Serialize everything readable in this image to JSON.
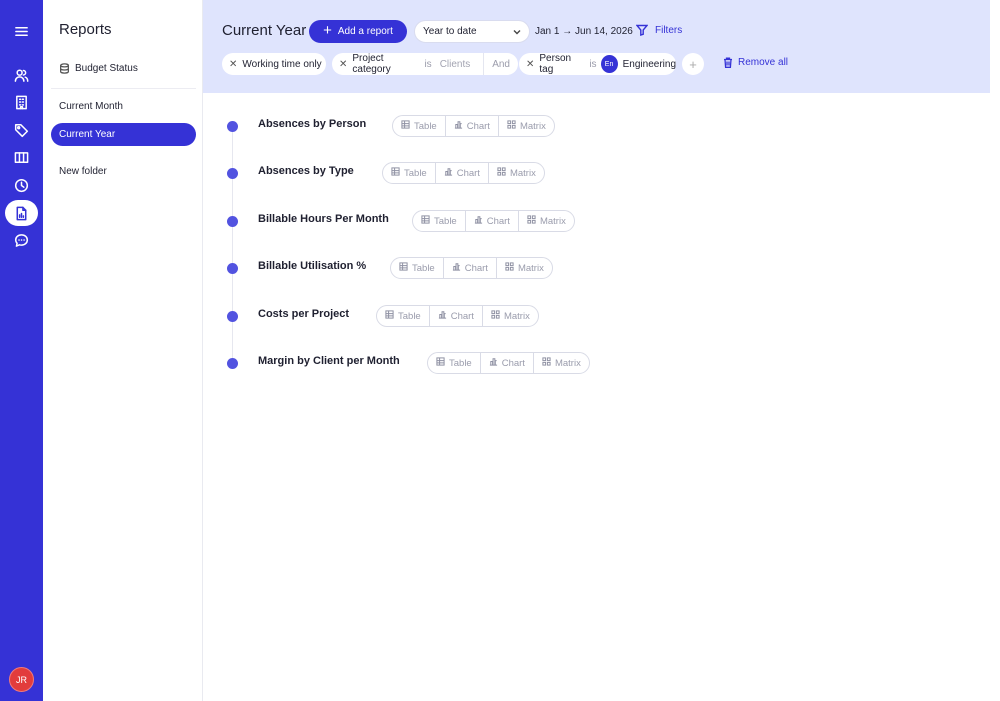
{
  "rail": {
    "icons": [
      "menu-icon",
      "people-icon",
      "building-icon",
      "tag-icon",
      "columns-icon",
      "clock-icon",
      "report-icon",
      "chat-icon"
    ],
    "active": "report-icon",
    "avatar_initials": "JR"
  },
  "panel": {
    "title": "Reports",
    "budget_status": "Budget Status",
    "current_month": "Current Month",
    "current_year": "Current Year",
    "new_folder": "New folder"
  },
  "header": {
    "title": "Current Year",
    "add_report": "Add a report",
    "range_select": "Year to date",
    "date_range": "Jan 1 → Jun 14, 2026",
    "filters": "Filters",
    "remove_all": "Remove all"
  },
  "filters": {
    "chip1": {
      "label": "Working time only"
    },
    "chip2": {
      "field": "Project category",
      "op": "is",
      "value": "Clients",
      "joiner": "And"
    },
    "chip3": {
      "field": "Person tag",
      "op": "is",
      "badge": "En",
      "value": "Engineering"
    }
  },
  "view_labels": {
    "table": "Table",
    "chart": "Chart",
    "matrix": "Matrix"
  },
  "reports": [
    {
      "name": "Absences by Person"
    },
    {
      "name": "Absences by Type"
    },
    {
      "name": "Billable Hours Per Month"
    },
    {
      "name": "Billable Utilisation %"
    },
    {
      "name": "Costs per Project"
    },
    {
      "name": "Margin by Client per Month"
    }
  ],
  "colors": {
    "accent": "#3532d6",
    "header_bg": "#dfe4fd",
    "avatar": "#e23c3c"
  }
}
